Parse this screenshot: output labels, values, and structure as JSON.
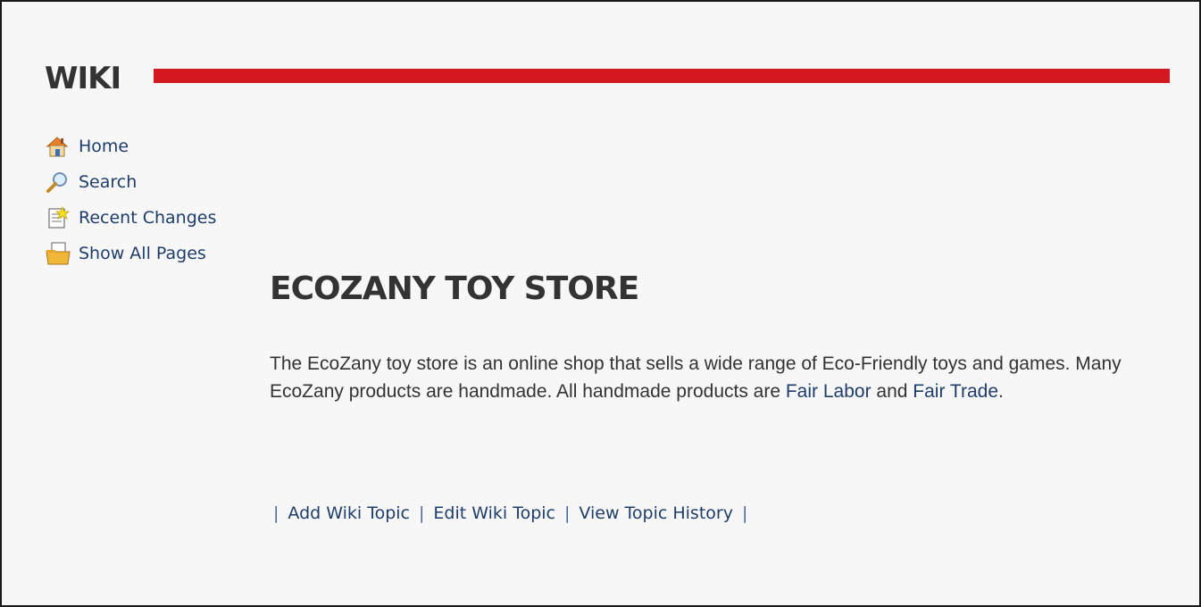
{
  "header": {
    "title": "WIKI",
    "rule_color": "#d4181f"
  },
  "nav": {
    "items": [
      {
        "label": "Home",
        "icon": "home-icon"
      },
      {
        "label": "Search",
        "icon": "search-icon"
      },
      {
        "label": "Recent Changes",
        "icon": "recent-changes-icon"
      },
      {
        "label": "Show All Pages",
        "icon": "all-pages-icon"
      }
    ]
  },
  "topic": {
    "title": "ECOZANY TOY STORE",
    "body_text_1": "The EcoZany toy store is an online shop that sells a wide range of Eco-Friendly toys and games. Many EcoZany products are handmade. All handmade products are ",
    "link_fair_labor": "Fair Labor",
    "body_text_2": " and ",
    "link_fair_trade": "Fair Trade",
    "body_text_3": "."
  },
  "actions": {
    "separator": "|",
    "add": "Add Wiki Topic",
    "edit": "Edit Wiki Topic",
    "history": "View Topic History"
  }
}
